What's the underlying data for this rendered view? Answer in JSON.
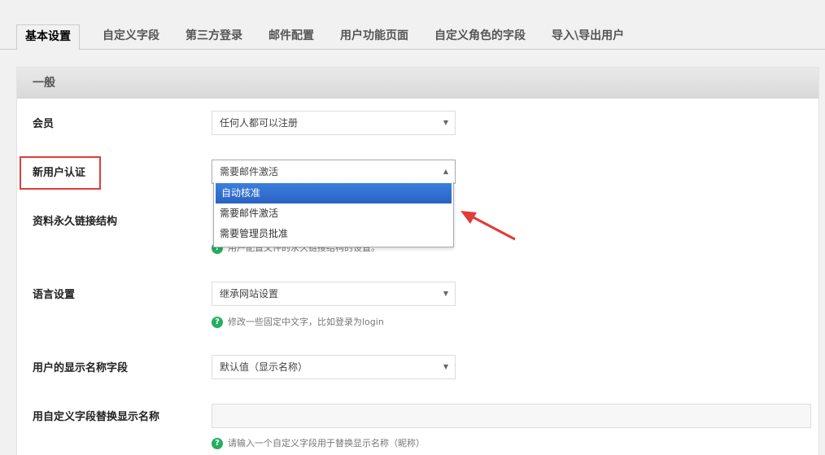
{
  "tabs": [
    "基本设置",
    "自定义字段",
    "第三方登录",
    "邮件配置",
    "用户功能页面",
    "自定义角色的字段",
    "导入\\导出用户"
  ],
  "section_title": "一般",
  "fields": {
    "membership": {
      "label": "会员",
      "value": "任何人都可以注册"
    },
    "new_user_auth": {
      "label": "新用户认证",
      "value": "需要邮件激活",
      "options": [
        "自动核准",
        "需要邮件激活",
        "需要管理员批准"
      ],
      "highlighted_option": "自动核准"
    },
    "permalink": {
      "label": "资料永久链接结构",
      "help": "用户配置文件的永久链接结构的设置。"
    },
    "language": {
      "label": "语言设置",
      "value": "继承网站设置",
      "help": "修改一些固定中文字，比如登录为login"
    },
    "display_name": {
      "label": "用户的显示名称字段",
      "value": "默认值（显示名称）"
    },
    "custom_display": {
      "label": "用自定义字段替换显示名称",
      "value": "",
      "help": "请输入一个自定义字段用于替换显示名称（昵称）"
    }
  },
  "icons": {
    "help": "question-circle-icon",
    "caret_down": "caret-down-icon",
    "caret_up": "caret-up-icon"
  },
  "colors": {
    "highlight": "#3875d7",
    "help_icon": "#27ae60",
    "annotation": "#e23b3b"
  }
}
